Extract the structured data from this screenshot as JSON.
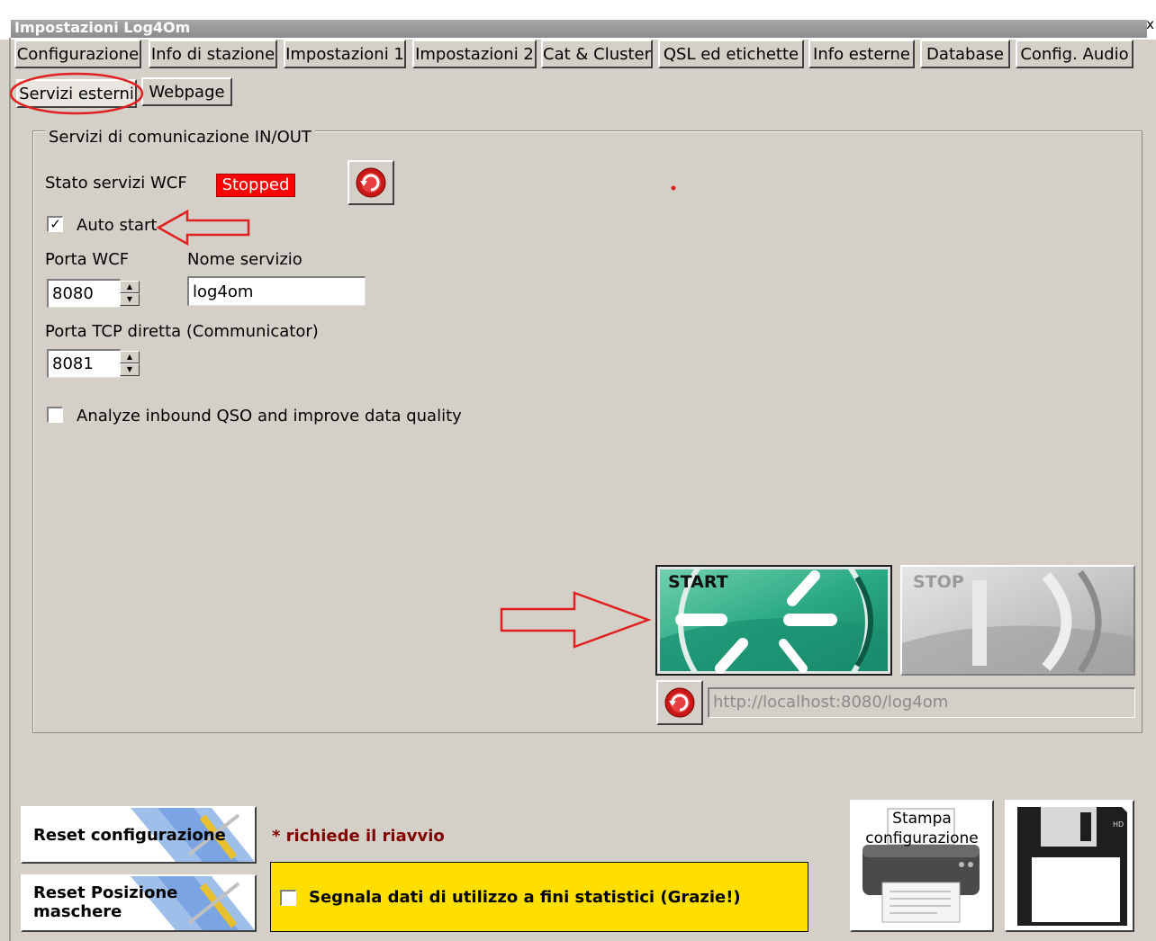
{
  "window": {
    "title": "Impostazioni Log4Om",
    "close_glyph": "x"
  },
  "tabs_row1": [
    {
      "label": "Configurazione"
    },
    {
      "label": "Info di stazione"
    },
    {
      "label": "Impostazioni 1"
    },
    {
      "label": "Impostazioni 2"
    },
    {
      "label": "Cat & Cluster"
    },
    {
      "label": "QSL ed etichette"
    },
    {
      "label": "Info esterne"
    },
    {
      "label": "Database"
    },
    {
      "label": "Config. Audio"
    }
  ],
  "tabs_row2": [
    {
      "label": "Servizi esterni",
      "active": true
    },
    {
      "label": "Webpage",
      "active": false
    }
  ],
  "group": {
    "title": "Servizi di comunicazione IN/OUT",
    "wcf_status_label": "Stato servizi WCF",
    "wcf_status_value": "Stopped",
    "auto_start_label": "Auto start",
    "auto_start_checked": true,
    "wcf_port_label": "Porta WCF",
    "wcf_port_value": "8080",
    "service_name_label": "Nome servizio",
    "service_name_value": "log4om",
    "tcp_port_label": "Porta TCP diretta (Communicator)",
    "tcp_port_value": "8081",
    "analyze_label": "Analyze inbound QSO and improve data quality",
    "analyze_checked": false,
    "start_label": "START",
    "stop_label": "STOP",
    "url_value": "http://localhost:8080/log4om"
  },
  "footer": {
    "reset_config_label": "Reset configurazione",
    "reset_positions_label_1": "Reset Posizione",
    "reset_positions_label_2": "maschere",
    "restart_note": "* richiede il riavvio",
    "usage_stats_label": "Segnala dati di utilizzo a fini statistici (Grazie!)",
    "usage_stats_checked": false,
    "print_label_1": "Stampa",
    "print_label_2": "configurazione"
  },
  "colors": {
    "status_stopped": "#ff0000",
    "annotation_red": "#e02020",
    "start_green": "#2aa982",
    "note_dark_red": "#800000",
    "stats_yellow": "#ffdf00"
  }
}
